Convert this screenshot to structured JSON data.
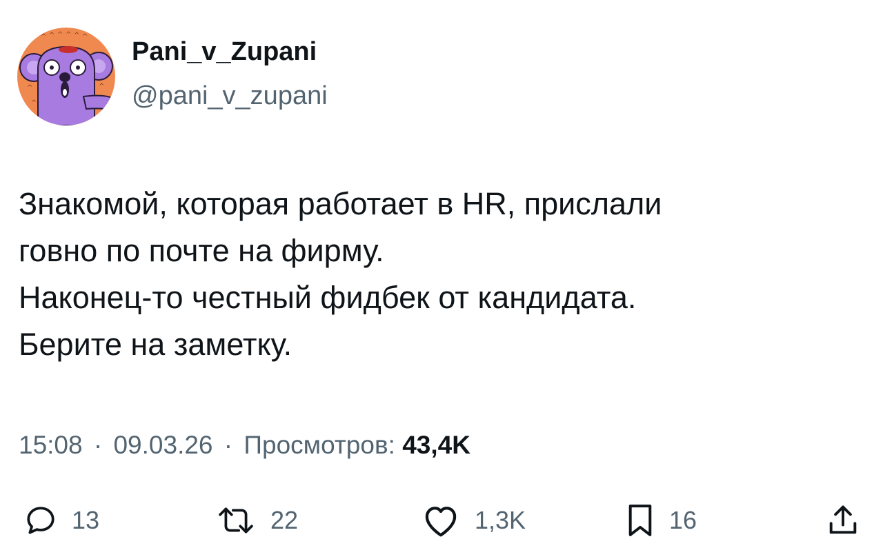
{
  "author": {
    "display_name": "Pani_v_Zupani",
    "handle": "@pani_v_zupani",
    "avatar_icon": "koala-avatar-icon"
  },
  "tweet": {
    "lines": [
      "Знакомой, которая работает в HR, прислали",
      "говно по почте на фирму.",
      "Наконец-то честный фидбек от кандидата.",
      "Берите на заметку."
    ]
  },
  "meta": {
    "time": "15:08",
    "separator": "·",
    "date": "09.03.26",
    "views_label": "Просмотров:",
    "views_count": "43,4K"
  },
  "actions": {
    "reply": {
      "icon": "reply-icon",
      "count": "13"
    },
    "retweet": {
      "icon": "retweet-icon",
      "count": "22"
    },
    "like": {
      "icon": "heart-icon",
      "count": "1,3K"
    },
    "bookmark": {
      "icon": "bookmark-icon",
      "count": "16"
    },
    "share": {
      "icon": "share-icon"
    }
  },
  "colors": {
    "text_primary": "#0f1419",
    "text_secondary": "#536471",
    "avatar_bg": "#f0894f",
    "avatar_koala": "#a77be0"
  }
}
